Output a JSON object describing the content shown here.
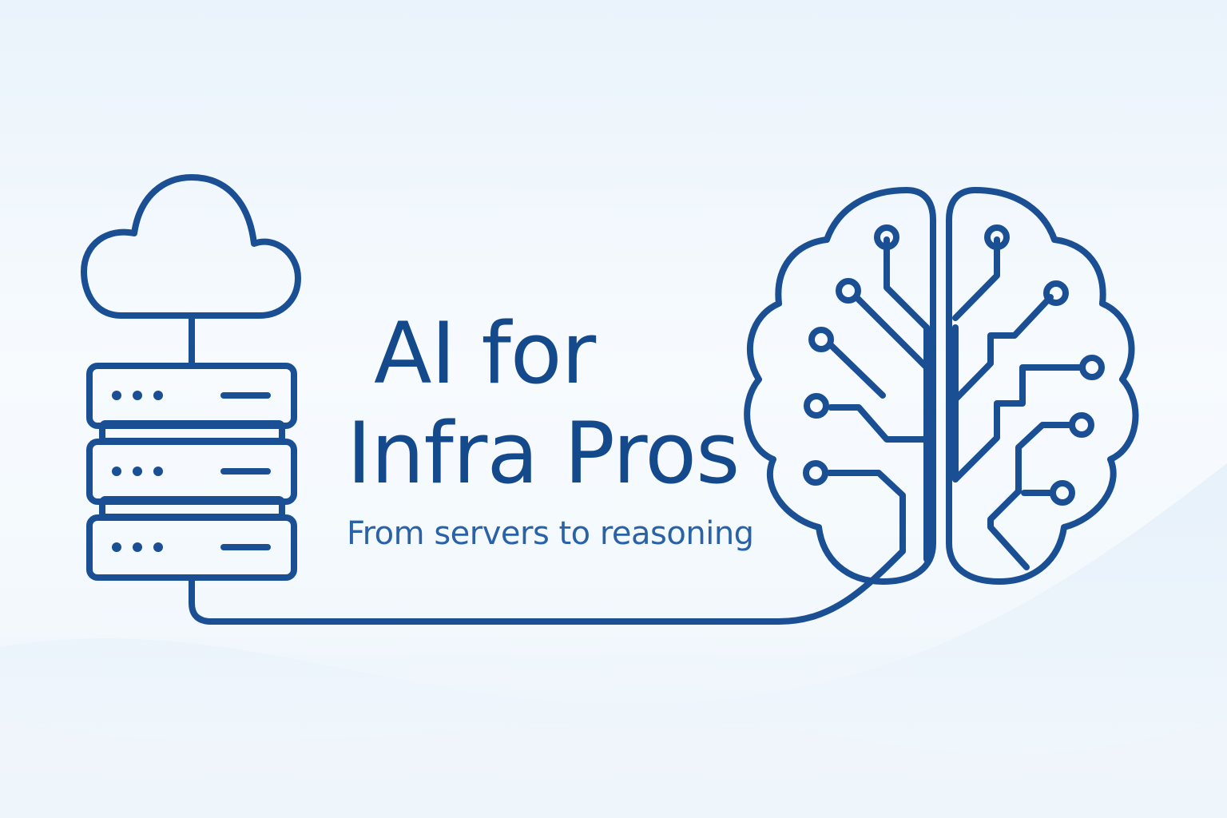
{
  "title": {
    "line1": "AI for",
    "line2": "Infra Pros"
  },
  "subtitle": "From servers to reasoning",
  "colors": {
    "outline": "#1b4f93",
    "title": "#144a8c",
    "subtitle": "#2a62a8",
    "brain_fill": "#bcd8f1"
  },
  "icons": [
    "cloud-icon",
    "server-rack-icon",
    "circuit-brain-icon"
  ]
}
